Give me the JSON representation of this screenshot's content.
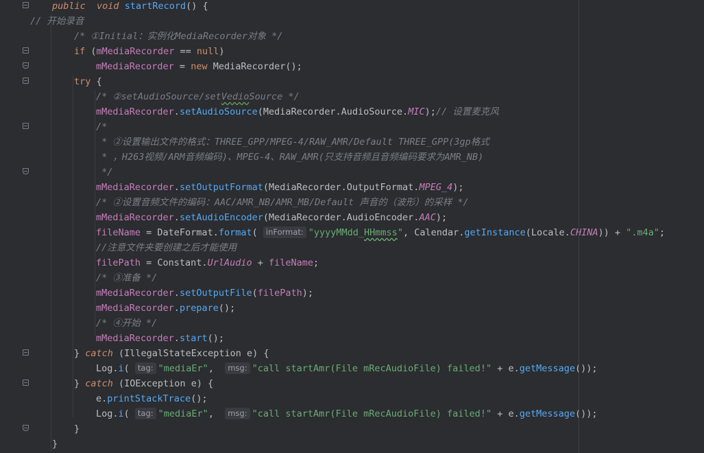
{
  "lines": [
    {
      "segments": [
        [
          "kw",
          "public"
        ],
        [
          "",
          "  "
        ],
        [
          "kw",
          "void"
        ],
        [
          "",
          " "
        ],
        [
          "fn",
          "startRecord"
        ],
        [
          "",
          "() {"
        ]
      ]
    },
    {
      "segments": [
        [
          "cm",
          "// 开始录音"
        ]
      ]
    },
    {
      "segments": [
        [
          "cm",
          "/* ①Initial：实例化MediaRecorder对象 */"
        ]
      ]
    },
    {
      "segments": [
        [
          "kwn",
          "if"
        ],
        [
          "",
          " ("
        ],
        [
          "fld",
          "mMediaRecorder"
        ],
        [
          "",
          " == "
        ],
        [
          "kwn",
          "null"
        ],
        [
          "",
          ")"
        ]
      ]
    },
    {
      "segments": [
        [
          "fld",
          "mMediaRecorder"
        ],
        [
          "",
          " = "
        ],
        [
          "kwn",
          "new"
        ],
        [
          "",
          " MediaRecorder();"
        ]
      ]
    },
    {
      "segments": [
        [
          "kwn",
          "try"
        ],
        [
          "",
          " {"
        ]
      ]
    },
    {
      "segments": [
        [
          "cm",
          "/* ②setAudioSource/set"
        ],
        [
          "cm sq",
          "Vedio"
        ],
        [
          "cm",
          "Source */"
        ]
      ]
    },
    {
      "segments": [
        [
          "fld",
          "mMediaRecorder"
        ],
        [
          "",
          "."
        ],
        [
          "fn",
          "setAudioSource"
        ],
        [
          "",
          "(MediaRecorder.AudioSource."
        ],
        [
          "cst",
          "MIC"
        ],
        [
          "",
          ");"
        ],
        [
          "cm",
          "// 设置麦克风"
        ]
      ]
    },
    {
      "segments": [
        [
          "cm",
          "/*"
        ]
      ]
    },
    {
      "segments": [
        [
          "cm",
          " * ②设置输出文件的格式：THREE_GPP/MPEG-4/RAW_AMR/Default THREE_GPP(3gp格式"
        ]
      ]
    },
    {
      "segments": [
        [
          "cm",
          " * ，H263视频/ARM音频编码)、MPEG-4、RAW_AMR(只支持音频且音频编码要求为AMR_NB)"
        ]
      ]
    },
    {
      "segments": [
        [
          "cm",
          " */"
        ]
      ]
    },
    {
      "segments": [
        [
          "fld",
          "mMediaRecorder"
        ],
        [
          "",
          "."
        ],
        [
          "fn",
          "setOutputFormat"
        ],
        [
          "",
          "(MediaRecorder.OutputFormat."
        ],
        [
          "cst",
          "MPEG_4"
        ],
        [
          "",
          ");"
        ]
      ]
    },
    {
      "segments": [
        [
          "cm",
          "/* ②设置音频文件的编码：AAC/AMR_NB/AMR_MB/Default 声音的（波形）的采样 */"
        ]
      ]
    },
    {
      "segments": [
        [
          "fld",
          "mMediaRecorder"
        ],
        [
          "",
          "."
        ],
        [
          "fn",
          "setAudioEncoder"
        ],
        [
          "",
          "(MediaRecorder.AudioEncoder."
        ],
        [
          "cst",
          "AAC"
        ],
        [
          "",
          ");"
        ]
      ]
    },
    {
      "segments": [
        [
          "fld",
          "fileName"
        ],
        [
          "",
          " = DateFormat."
        ],
        [
          "fn",
          "format"
        ],
        [
          "",
          "( "
        ],
        [
          "hint",
          "inFormat:"
        ],
        [
          "str",
          "\"yyyyMMdd_"
        ],
        [
          "str sq",
          "HHmmss"
        ],
        [
          "str",
          "\""
        ],
        [
          "",
          ", Calendar."
        ],
        [
          "fn",
          "getInstance"
        ],
        [
          "",
          "(Locale."
        ],
        [
          "cst",
          "CHINA"
        ],
        [
          "",
          ")) + "
        ],
        [
          "str",
          "\".m4a\""
        ],
        [
          "",
          ";"
        ]
      ]
    },
    {
      "segments": [
        [
          "cm",
          "//注意文件夹要创建之后才能使用"
        ]
      ]
    },
    {
      "segments": [
        [
          "fld",
          "filePath"
        ],
        [
          "",
          " = Constant."
        ],
        [
          "cst",
          "UrlAudio"
        ],
        [
          "",
          " + "
        ],
        [
          "fld",
          "fileName"
        ],
        [
          "",
          ";"
        ]
      ]
    },
    {
      "segments": [
        [
          "cm",
          "/* ③准备 */"
        ]
      ]
    },
    {
      "segments": [
        [
          "fld",
          "mMediaRecorder"
        ],
        [
          "",
          "."
        ],
        [
          "fn",
          "setOutputFile"
        ],
        [
          "",
          "("
        ],
        [
          "fld",
          "filePath"
        ],
        [
          "",
          ");"
        ]
      ]
    },
    {
      "segments": [
        [
          "fld",
          "mMediaRecorder"
        ],
        [
          "",
          "."
        ],
        [
          "fn",
          "prepare"
        ],
        [
          "",
          "();"
        ]
      ]
    },
    {
      "segments": [
        [
          "cm",
          "/* ④开始 */"
        ]
      ]
    },
    {
      "segments": [
        [
          "fld",
          "mMediaRecorder"
        ],
        [
          "",
          "."
        ],
        [
          "fn",
          "start"
        ],
        [
          "",
          "();"
        ]
      ]
    },
    {
      "segments": [
        [
          "",
          "} "
        ],
        [
          "kw",
          "catch"
        ],
        [
          "",
          " (IllegalStateException "
        ],
        [
          "",
          "e"
        ],
        [
          "",
          ") {"
        ]
      ]
    },
    {
      "segments": [
        [
          "",
          "Log."
        ],
        [
          "fn",
          "i"
        ],
        [
          "",
          "( "
        ],
        [
          "hint",
          "tag:"
        ],
        [
          "str",
          "\"mediaEr\""
        ],
        [
          "",
          ",  "
        ],
        [
          "hint",
          "msg:"
        ],
        [
          "str",
          "\"call startAmr(File mRecAudioFile) failed!\""
        ],
        [
          "",
          " + e."
        ],
        [
          "fn",
          "getMessage"
        ],
        [
          "",
          "());"
        ]
      ]
    },
    {
      "segments": [
        [
          "",
          "} "
        ],
        [
          "kw",
          "catch"
        ],
        [
          "",
          " (IOException "
        ],
        [
          "",
          "e"
        ],
        [
          "",
          ") {"
        ]
      ]
    },
    {
      "segments": [
        [
          "",
          "e."
        ],
        [
          "fn",
          "printStackTrace"
        ],
        [
          "",
          "();"
        ]
      ]
    },
    {
      "segments": [
        [
          "",
          "Log."
        ],
        [
          "fn",
          "i"
        ],
        [
          "",
          "( "
        ],
        [
          "hint",
          "tag:"
        ],
        [
          "str",
          "\"mediaEr\""
        ],
        [
          "",
          ",  "
        ],
        [
          "hint",
          "msg:"
        ],
        [
          "str",
          "\"call startAmr(File mRecAudioFile) failed!\""
        ],
        [
          "",
          " + e."
        ],
        [
          "fn",
          "getMessage"
        ],
        [
          "",
          "());"
        ]
      ]
    },
    {
      "segments": [
        [
          "",
          "}"
        ]
      ]
    },
    {
      "segments": [
        [
          "",
          "}"
        ]
      ]
    }
  ],
  "colors": {
    "background": "#2b2d30",
    "keyword": "#cf8e6d",
    "method": "#56a8f5",
    "field": "#c77dbb",
    "string": "#6aab73",
    "comment": "#7a7e85",
    "text": "#bcbec4"
  },
  "icons": {
    "fold": "fold-marker-icon"
  }
}
